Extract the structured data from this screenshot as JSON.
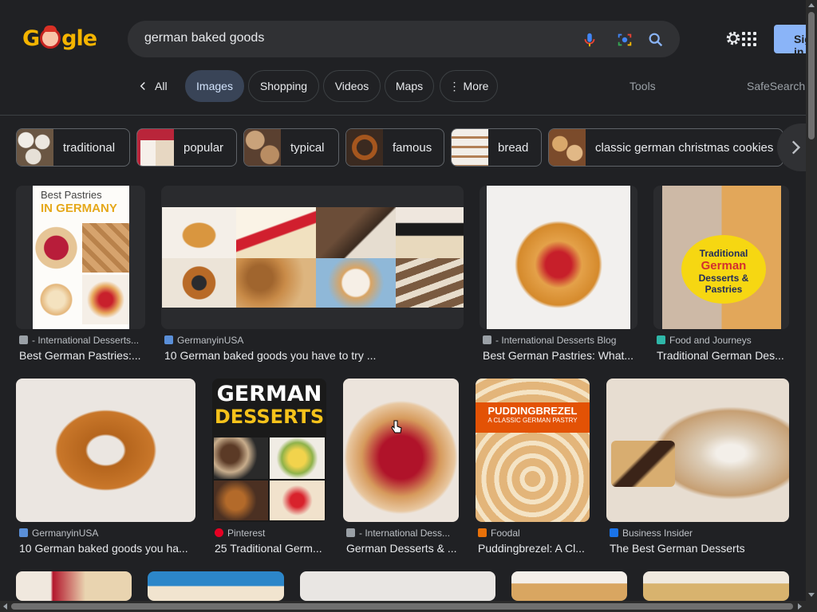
{
  "logo": {
    "g1": "G",
    "g2": "gle"
  },
  "search": {
    "query": "german baked goods",
    "placeholder": "Search"
  },
  "header": {
    "signin_label": "Sign in"
  },
  "tabs": {
    "all": "All",
    "images": "Images",
    "shopping": "Shopping",
    "videos": "Videos",
    "maps": "Maps",
    "more": "More",
    "tools": "Tools",
    "safesearch": "SafeSearch"
  },
  "chips": [
    {
      "label": "traditional"
    },
    {
      "label": "popular"
    },
    {
      "label": "typical"
    },
    {
      "label": "famous"
    },
    {
      "label": "bread"
    },
    {
      "label": "classic german christmas cookies"
    }
  ],
  "results_row1": [
    {
      "source": "- International Desserts...",
      "title": "Best German Pastries:...",
      "overlay_line1": "Best Pastries",
      "overlay_line2": "IN GERMANY"
    },
    {
      "source": "GermanyinUSA",
      "title": "10 German baked goods you have to try ..."
    },
    {
      "source": "- International Desserts Blog",
      "title": "Best German Pastries: What..."
    },
    {
      "source": "Food and Journeys",
      "title": "Traditional German Des...",
      "overlay_line1": "Traditional",
      "overlay_line2": "German",
      "overlay_line3": "Desserts &",
      "overlay_line4": "Pastries"
    }
  ],
  "results_row2": [
    {
      "source": "GermanyinUSA",
      "title": "10 German baked goods you ha..."
    },
    {
      "source": "Pinterest",
      "title": "25 Traditional Germ...",
      "overlay_line1": "GERMAN",
      "overlay_line2": "DESSERTS"
    },
    {
      "source": "- International Dess...",
      "title": "German Desserts & ..."
    },
    {
      "source": "Foodal",
      "title": "Puddingbrezel: A Cl...",
      "overlay_line1": "PUDDINGBREZEL",
      "overlay_line2": "A CLASSIC GERMAN PASTRY"
    },
    {
      "source": "Business Insider",
      "title": "The Best German Desserts"
    }
  ],
  "colors": {
    "background": "#202124",
    "search_bg": "#303134",
    "accent": "#8ab4f8",
    "active_tab": "#394457"
  }
}
